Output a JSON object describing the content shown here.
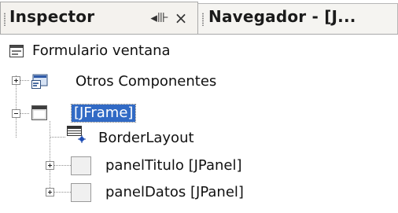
{
  "tabs": {
    "inspector": {
      "title": "Inspector",
      "dock_glyph": "◂⊪",
      "close_glyph": "×"
    },
    "navigator": {
      "title": "Navegador - [J..."
    }
  },
  "tree": {
    "root": {
      "label": "Formulario ventana",
      "icon": "form-window-icon"
    },
    "other_components": {
      "label": "Otros Componentes",
      "icon": "components-icon",
      "expanded": false
    },
    "jframe": {
      "label": "[JFrame]",
      "icon": "frame-icon",
      "expanded": true,
      "selected": true
    },
    "border_layout": {
      "label": "BorderLayout",
      "icon": "layout-icon"
    },
    "panel_titulo": {
      "label": "panelTitulo [JPanel]",
      "icon": "panel-icon",
      "expanded": false
    },
    "panel_datos": {
      "label": "panelDatos [JPanel]",
      "icon": "panel-icon",
      "expanded": false
    }
  },
  "colors": {
    "selection": "#316ac5",
    "tab_bg": "#f4f2ee",
    "border": "#a9a9a9"
  }
}
